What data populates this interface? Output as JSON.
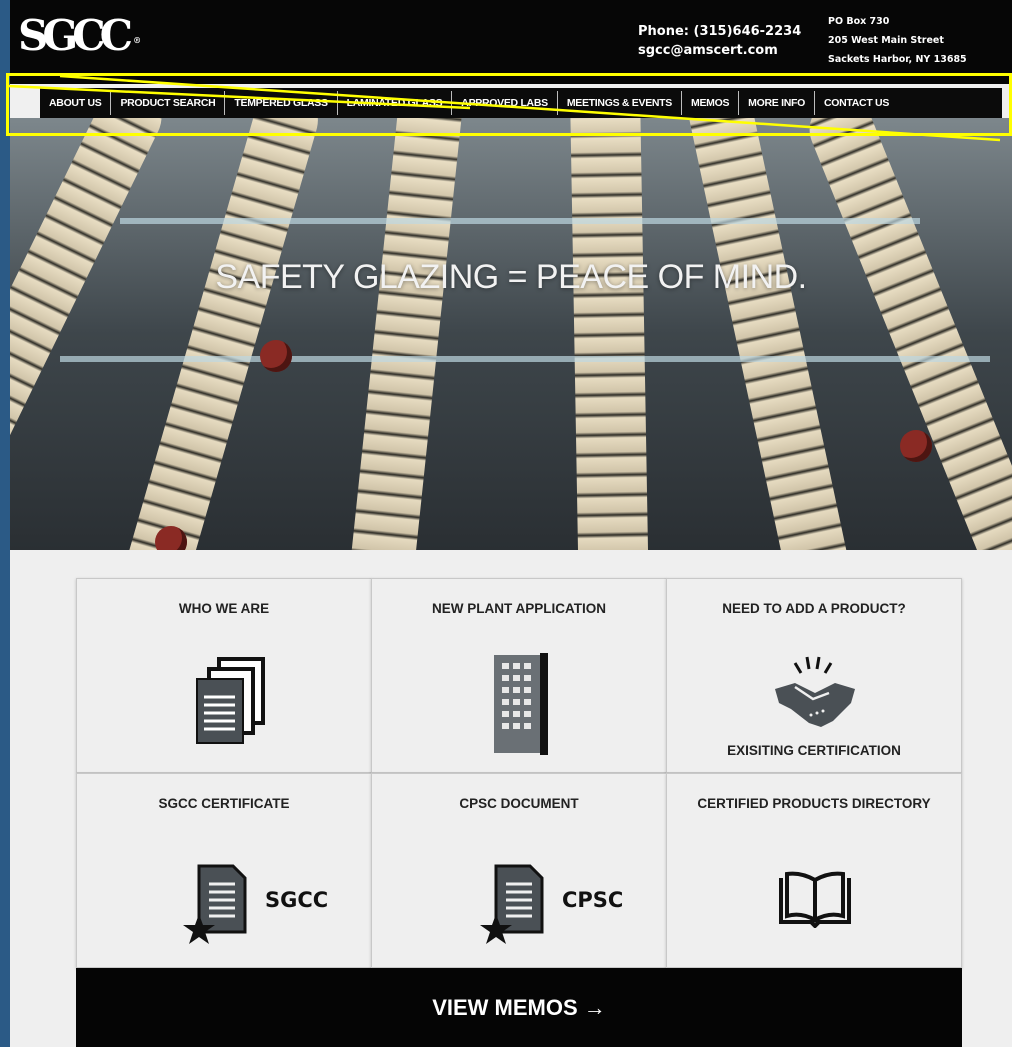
{
  "header": {
    "logo": "SGCC",
    "phone": "Phone: (315)646-2234",
    "email": "sgcc@amscert.com",
    "address_line1": "PO Box 730",
    "address_line2": "205 West Main Street",
    "address_line3": "Sackets Harbor, NY 13685"
  },
  "nav": {
    "items": [
      "ABOUT US",
      "PRODUCT SEARCH",
      "TEMPERED GLASS",
      "LAMINATED GLASS",
      "APPROVED LABS",
      "MEETINGS & EVENTS",
      "MEMOS",
      "MORE INFO",
      "CONTACT US"
    ]
  },
  "hero": {
    "title": "SAFETY GLAZING = PEACE OF MIND."
  },
  "cards": {
    "who_we_are": "WHO WE ARE",
    "new_plant": "NEW PLANT APPLICATION",
    "add_product": "NEED TO ADD A PRODUCT?",
    "existing_cert": "EXISITING CERTIFICATION",
    "sgcc_certificate": "SGCC CERTIFICATE",
    "sgcc_label": "SGCC",
    "cpsc_document": "CPSC DOCUMENT",
    "cpsc_label": "CPSC",
    "directory": "CERTIFIED PRODUCTS DIRECTORY"
  },
  "memos_button": "VIEW MEMOS  →",
  "colors": {
    "frame": "#2b5a86",
    "header_bg": "#060606",
    "annotation": "#ffff00",
    "icon_gray": "#4a5055"
  },
  "icons": [
    "documents-icon",
    "building-icon",
    "handshake-icon",
    "certificate-icon",
    "book-icon",
    "star-icon"
  ]
}
